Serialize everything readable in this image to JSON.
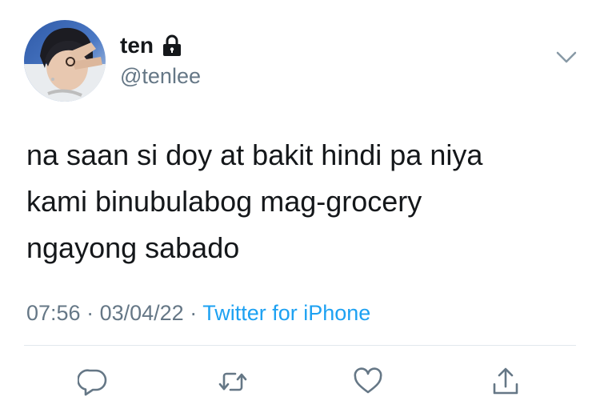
{
  "author": {
    "display_name": "ten",
    "handle": "@tenlee",
    "protected_icon": "lock-icon",
    "avatar": "profile-photo"
  },
  "tweet": {
    "text": "na saan si doy at bakit hindi pa niya\nkami binubulabog mag-grocery\nngayong sabado",
    "time": "07:56",
    "separator1": " · ",
    "date": "03/04/22",
    "separator2": " · ",
    "source": "Twitter for iPhone"
  },
  "menu": {
    "icon": "chevron-down-icon"
  },
  "actions": [
    {
      "icon": "reply-icon"
    },
    {
      "icon": "retweet-icon"
    },
    {
      "icon": "like-icon"
    },
    {
      "icon": "share-icon"
    }
  ],
  "colors": {
    "text": "#14171a",
    "secondary": "#657786",
    "link": "#1da1f2",
    "divider": "#e1e8ed"
  }
}
